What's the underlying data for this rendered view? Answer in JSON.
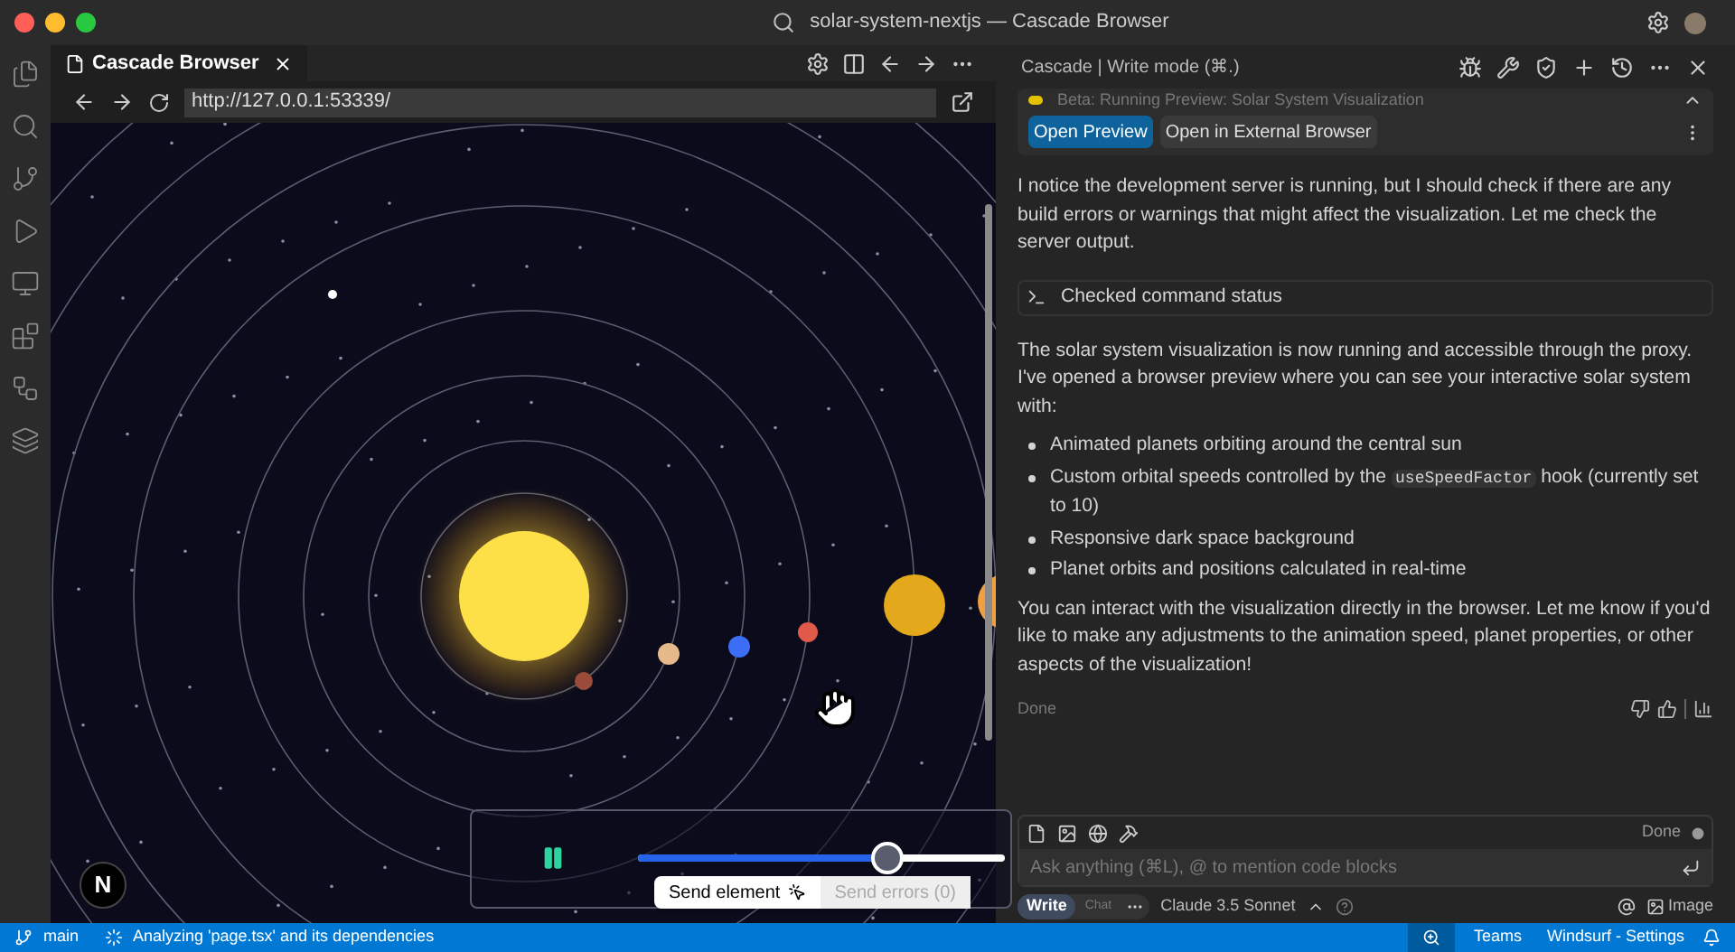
{
  "window": {
    "title": "solar-system-nextjs — Cascade Browser"
  },
  "browser": {
    "tab": {
      "title": "Cascade Browser",
      "selected": true
    },
    "url": "http://127.0.0.1:53339/",
    "badge": "N"
  },
  "preview_toolbar": {
    "level": 0.68,
    "buttons": [
      {
        "label": "Send element",
        "disabled": false
      },
      {
        "label": "Send errors (0)",
        "disabled": true
      }
    ]
  },
  "cascade": {
    "title": "Cascade | Write mode (⌘.)",
    "banner": {
      "text": "Beta: Running Preview: Solar System Visualization",
      "buttons": [
        {
          "label": "Open Preview",
          "primary": true
        },
        {
          "label": "Open in External Browser",
          "primary": false
        }
      ]
    },
    "messages": [
      {
        "kind": "paragraph",
        "text": "I notice the development server is running, but I should check if there are any build errors or warnings that might affect the visualization. Let me check the server output."
      },
      {
        "kind": "tool",
        "text": "Checked command status"
      },
      {
        "kind": "paragraph",
        "text": "The solar system visualization is now running and accessible through the proxy. I've opened a browser preview where you can see your interactive solar system with:"
      },
      {
        "kind": "list",
        "items": [
          {
            "text": "Animated planets orbiting around the central sun"
          },
          {
            "text": "Custom orbital speeds controlled by the ",
            "code": "useSpeedFactor",
            "after": " hook (currently set to 10)"
          },
          {
            "text": "Responsive dark space background"
          },
          {
            "text": "Planet orbits and positions calculated in real-time"
          }
        ]
      },
      {
        "kind": "paragraph",
        "text": "You can interact with the visualization directly in the browser. Let me know if you'd like to make any adjustments to the animation speed, planet properties, or other aspects of the visualization!"
      }
    ],
    "status": "Done",
    "input": {
      "placeholder": "Ask anything (⌘L), @ to mention code blocks",
      "state": "Done"
    },
    "modes": [
      {
        "label": "Write",
        "selected": true
      },
      {
        "label": "Chat",
        "selected": false
      }
    ],
    "model": "Claude 3.5 Sonnet",
    "image_button": "Image"
  },
  "status_bar": {
    "branch": "main",
    "task": "Analyzing 'page.tsx' and its dependencies",
    "items": [
      "Teams",
      "Windsurf - Settings"
    ]
  }
}
